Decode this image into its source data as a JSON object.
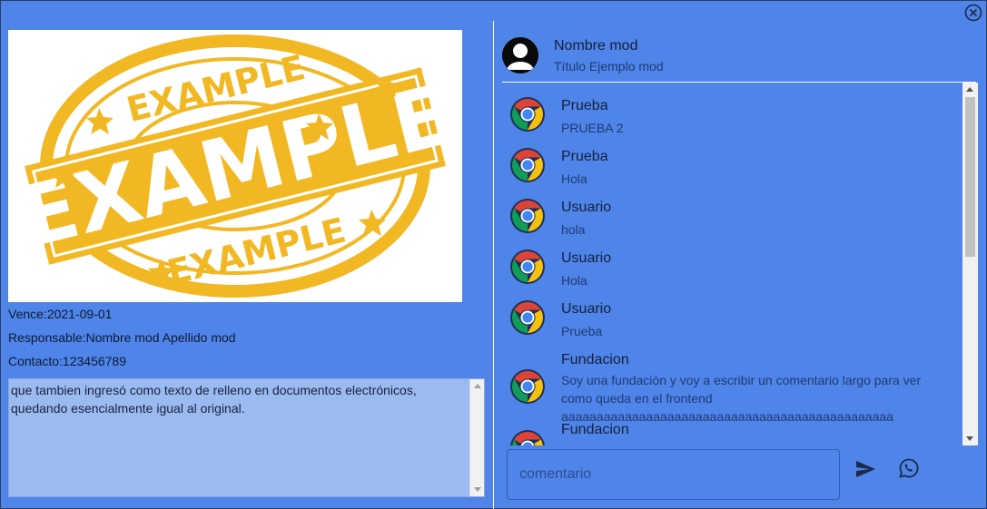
{
  "details": {
    "stamp_big": "EXAMPLE",
    "stamp_top": "EXAMPLE",
    "stamp_bottom": "EXAMPLE",
    "vence": "Vence:2021-09-01",
    "responsable": "Responsable:Nombre mod Apellido mod",
    "contacto": "Contacto:123456789",
    "description": "que tambien ingresó como texto de relleno en documentos electrónicos, quedando esencialmente igual al original."
  },
  "profile": {
    "name": "Nombre mod",
    "title": "Título Ejemplo mod"
  },
  "comments": [
    {
      "author": "Prueba",
      "text": "PRUEBA 2"
    },
    {
      "author": "Prueba",
      "text": "Hola"
    },
    {
      "author": "Usuario",
      "text": "hola"
    },
    {
      "author": "Usuario",
      "text": "Hola"
    },
    {
      "author": "Usuario",
      "text": "Prueba"
    },
    {
      "author": "Fundacion",
      "text": "Soy una fundación y voy a escribir un comentario largo para ver como queda en el frontend aaaaaaaaaaaaaaaaaaaaaaaaaaaaaaaaaaaaaaaaaaaaaaa"
    },
    {
      "author": "Fundacion",
      "text": ""
    }
  ],
  "composer": {
    "placeholder": "comentario"
  },
  "icons": {
    "close": "close-circle-icon",
    "send": "send-icon",
    "whatsapp": "whatsapp-icon",
    "avatar": "person-icon",
    "comment_avatar": "chrome-icon"
  },
  "colors": {
    "background": "#4f84e8",
    "stamp": "#f2b824",
    "textarea": "#9bbaf0"
  }
}
